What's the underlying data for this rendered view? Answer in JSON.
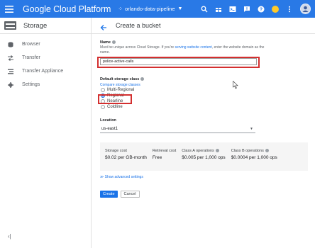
{
  "header": {
    "brand": "Google Cloud Platform",
    "project": "orlando-data-pipeline",
    "brand_color": "#2979e6"
  },
  "sidebar": {
    "title": "Storage",
    "items": [
      {
        "label": "Browser",
        "icon": "storage-disk-icon"
      },
      {
        "label": "Transfer",
        "icon": "transfer-arrows-icon"
      },
      {
        "label": "Transfer Appliance",
        "icon": "appliance-icon"
      },
      {
        "label": "Settings",
        "icon": "gear-icon"
      }
    ],
    "collapse_glyph": "‹|"
  },
  "main": {
    "title": "Create a bucket",
    "name": {
      "label": "Name",
      "note_prefix": "Must be unique across Cloud Storage. If you're ",
      "note_link": "serving website content",
      "note_suffix": ", enter the website domain as the name.",
      "value": "police-active-calls"
    },
    "storage_class": {
      "label": "Default storage class",
      "compare_link": "Compare storage classes",
      "options": [
        "Multi-Regional",
        "Regional",
        "Nearline",
        "Coldline"
      ],
      "selected": "Regional"
    },
    "location": {
      "label": "Location",
      "value": "us-east1"
    },
    "costs": [
      {
        "header": "Storage cost",
        "value": "$0.02 per GB-month"
      },
      {
        "header": "Retrieval cost",
        "value": "Free"
      },
      {
        "header": "Class A operations",
        "value": "$0.005 per 1,000 ops"
      },
      {
        "header": "Class B operations",
        "value": "$0.0004 per 1,000 ops"
      }
    ],
    "advanced_link": "Show advanced settings",
    "advanced_glyph": "≫",
    "create_label": "Create",
    "cancel_label": "Cancel",
    "highlight_color": "#d32f2f"
  }
}
